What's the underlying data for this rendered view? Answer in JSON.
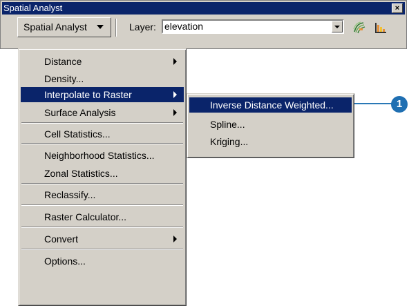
{
  "window": {
    "title": "Spatial Analyst",
    "close_label": "×"
  },
  "toolbar": {
    "menu_button_label": "Spatial Analyst",
    "layer_label": "Layer:",
    "layer_value": "elevation",
    "icons": [
      "contour-tool-icon",
      "histogram-icon"
    ]
  },
  "menu": {
    "items": [
      {
        "label": "Distance",
        "submenu": true
      },
      {
        "label": "Density...",
        "submenu": false
      },
      {
        "label": "Interpolate to Raster",
        "submenu": true,
        "highlighted": true
      },
      {
        "label": "Surface Analysis",
        "submenu": true
      },
      {
        "label": "Cell Statistics...",
        "submenu": false
      },
      {
        "label": "Neighborhood Statistics...",
        "submenu": false
      },
      {
        "label": "Zonal Statistics...",
        "submenu": false
      },
      {
        "label": "Reclassify...",
        "submenu": false
      },
      {
        "label": "Raster Calculator...",
        "submenu": false
      },
      {
        "label": "Convert",
        "submenu": true
      },
      {
        "label": "Options...",
        "submenu": false
      }
    ]
  },
  "submenu": {
    "items": [
      {
        "label": "Inverse Distance Weighted...",
        "highlighted": true
      },
      {
        "label": "Spline..."
      },
      {
        "label": "Kriging..."
      }
    ]
  },
  "callout": {
    "number": "1"
  },
  "colors": {
    "highlight": "#0a246a",
    "face": "#d4d0c8",
    "callout": "#1f6fb2"
  }
}
